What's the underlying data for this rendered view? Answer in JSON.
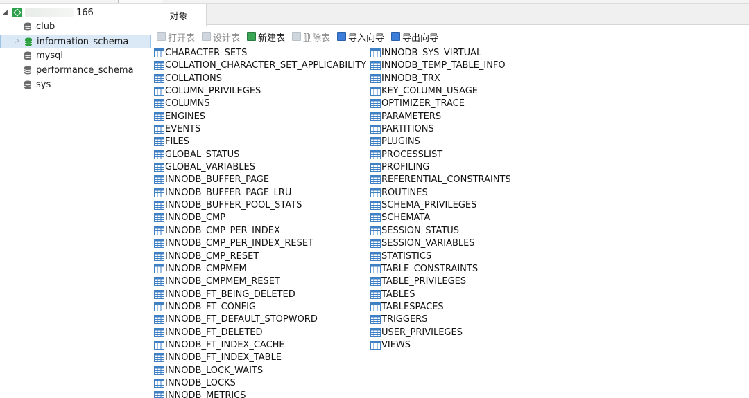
{
  "sidebar": {
    "connection": {
      "name": "166"
    },
    "databases": [
      {
        "name": "club"
      },
      {
        "name": "information_schema",
        "selected": true
      },
      {
        "name": "mysql"
      },
      {
        "name": "performance_schema"
      },
      {
        "name": "sys"
      }
    ]
  },
  "tabs": [
    {
      "label": "对象"
    }
  ],
  "toolbar": {
    "open_label": "打开表",
    "design_label": "设计表",
    "new_label": "新建表",
    "delete_label": "删除表",
    "import_label": "导入向导",
    "export_label": "导出向导"
  },
  "tables": {
    "column1": [
      "CHARACTER_SETS",
      "COLLATION_CHARACTER_SET_APPLICABILITY",
      "COLLATIONS",
      "COLUMN_PRIVILEGES",
      "COLUMNS",
      "ENGINES",
      "EVENTS",
      "FILES",
      "GLOBAL_STATUS",
      "GLOBAL_VARIABLES",
      "INNODB_BUFFER_PAGE",
      "INNODB_BUFFER_PAGE_LRU",
      "INNODB_BUFFER_POOL_STATS",
      "INNODB_CMP",
      "INNODB_CMP_PER_INDEX",
      "INNODB_CMP_PER_INDEX_RESET",
      "INNODB_CMP_RESET",
      "INNODB_CMPMEM",
      "INNODB_CMPMEM_RESET",
      "INNODB_FT_BEING_DELETED",
      "INNODB_FT_CONFIG",
      "INNODB_FT_DEFAULT_STOPWORD",
      "INNODB_FT_DELETED",
      "INNODB_FT_INDEX_CACHE",
      "INNODB_FT_INDEX_TABLE",
      "INNODB_LOCK_WAITS",
      "INNODB_LOCKS",
      "INNODB_METRICS"
    ],
    "column2": [
      "INNODB_SYS_VIRTUAL",
      "INNODB_TEMP_TABLE_INFO",
      "INNODB_TRX",
      "KEY_COLUMN_USAGE",
      "OPTIMIZER_TRACE",
      "PARAMETERS",
      "PARTITIONS",
      "PLUGINS",
      "PROCESSLIST",
      "PROFILING",
      "REFERENTIAL_CONSTRAINTS",
      "ROUTINES",
      "SCHEMA_PRIVILEGES",
      "SCHEMATA",
      "SESSION_STATUS",
      "SESSION_VARIABLES",
      "STATISTICS",
      "TABLE_CONSTRAINTS",
      "TABLE_PRIVILEGES",
      "TABLES",
      "TABLESPACES",
      "TRIGGERS",
      "USER_PRIVILEGES",
      "VIEWS"
    ]
  }
}
